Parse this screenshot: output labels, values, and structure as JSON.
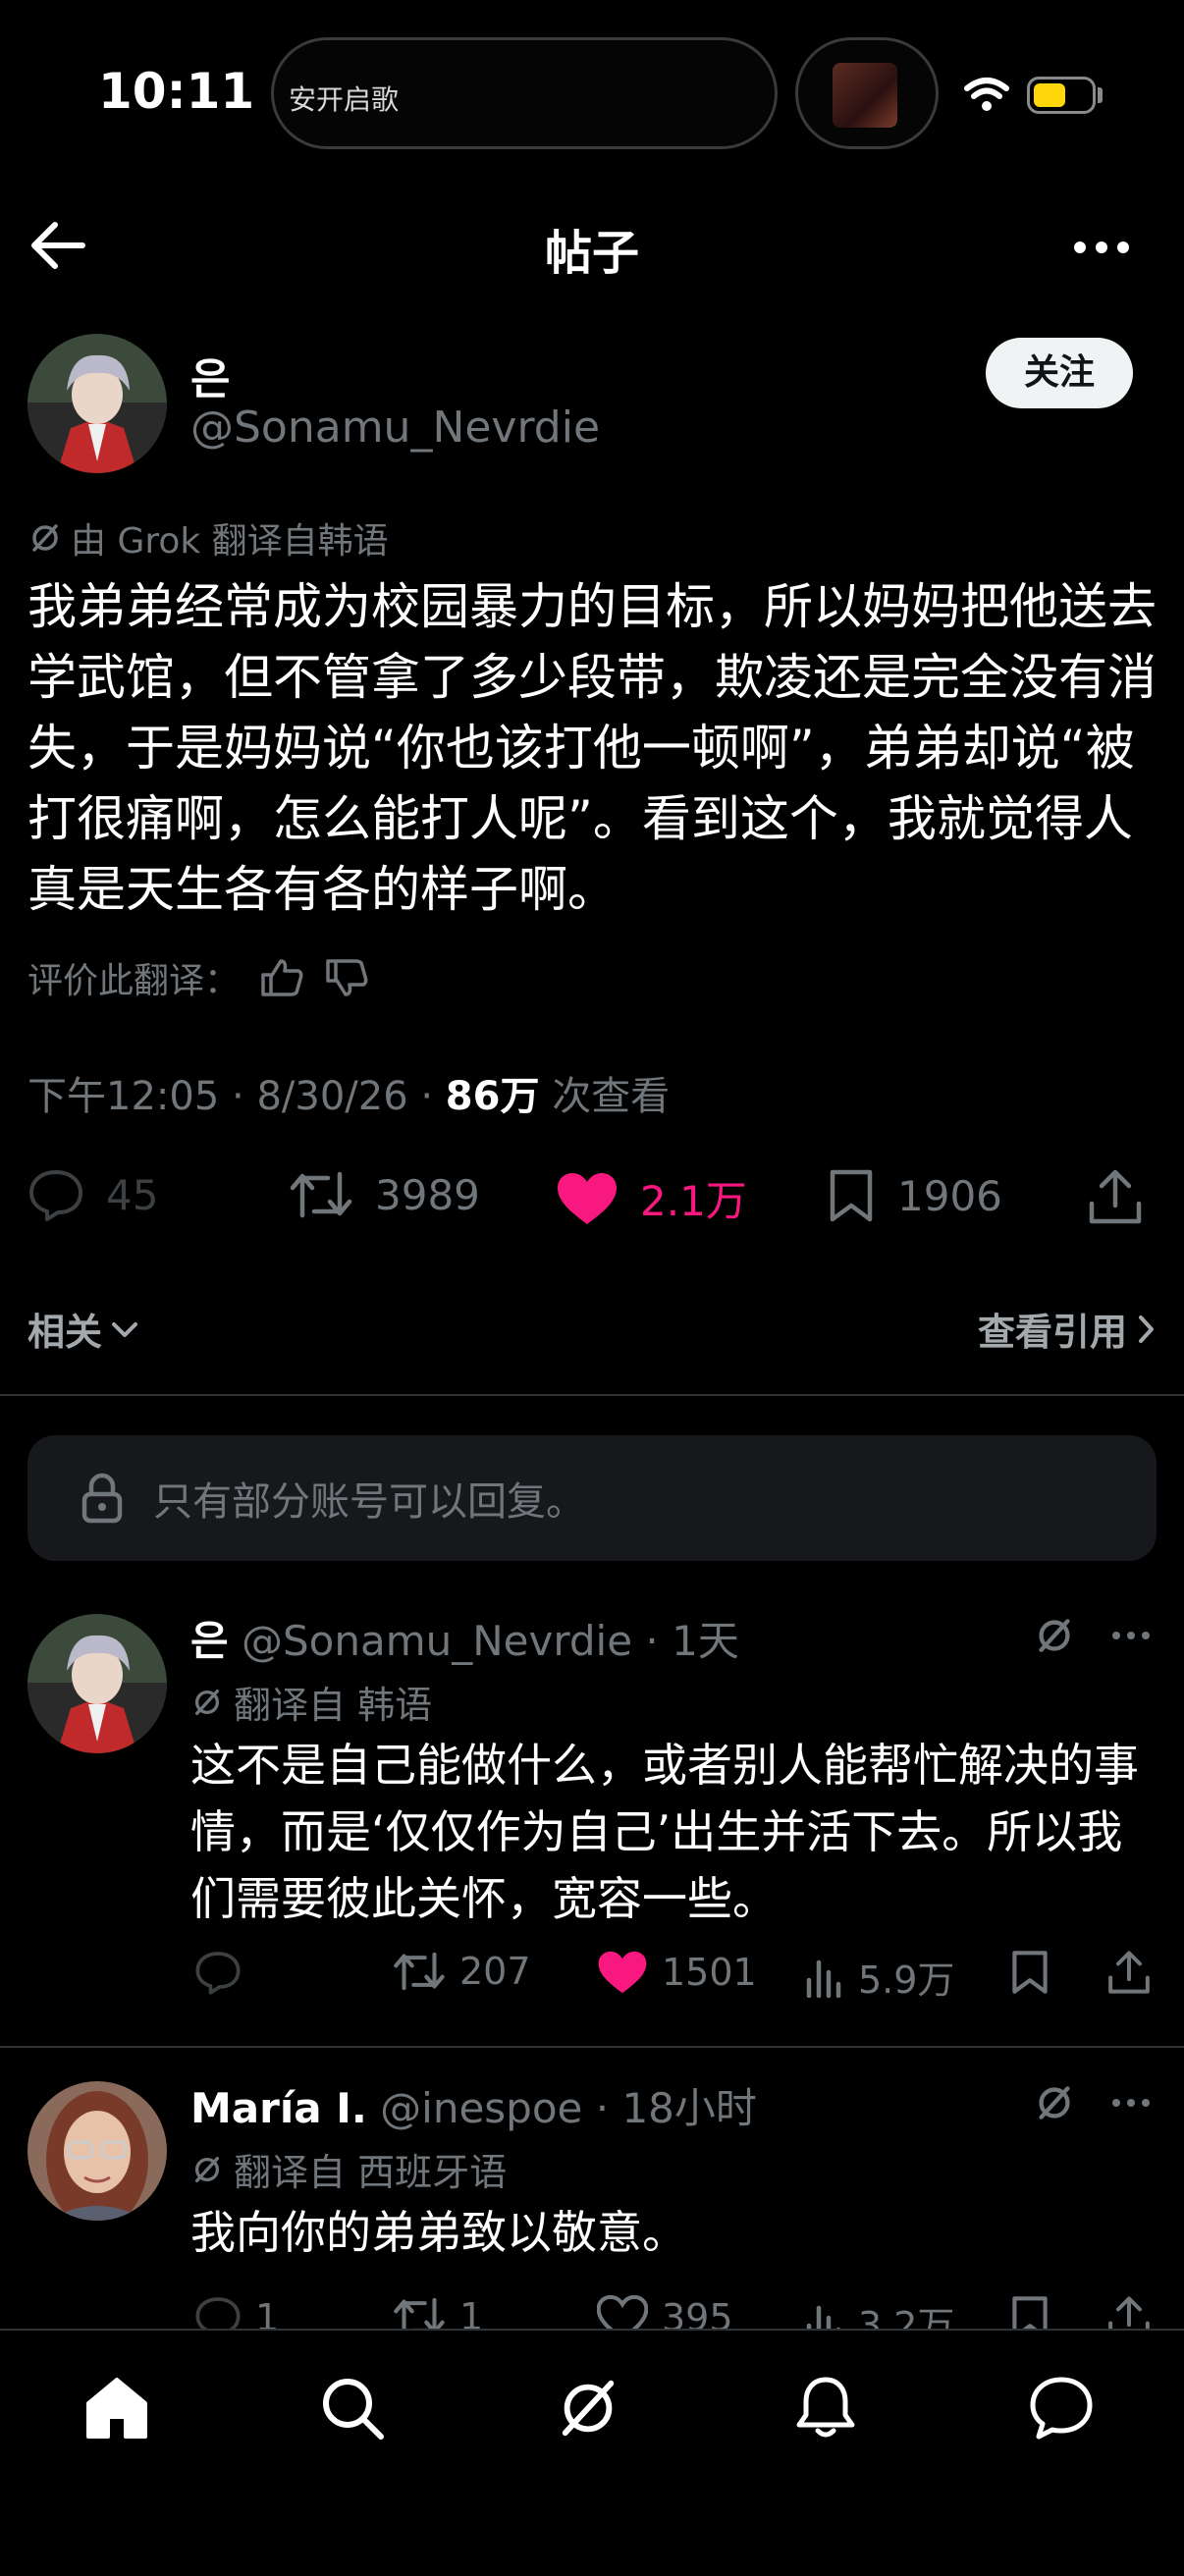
{
  "status_bar": {
    "time": "10:11",
    "now_playing": "安开启歌"
  },
  "header": {
    "title": "帖子"
  },
  "post": {
    "author_name": "은",
    "author_handle": "@Sonamu_Nevrdie",
    "follow_label": "关注",
    "translated_by": "由 Grok 翻译自韩语",
    "text": "我弟弟经常成为校园暴力的目标，所以妈妈把他送去学武馆，但不管拿了多少段带，欺凌还是完全没有消失，于是妈妈说“你也该打他一顿啊”，弟弟却说“被打很痛啊，怎么能打人呢”。看到这个，我就觉得人真是天生各有各的样子啊。",
    "rate_label": "评价此翻译：",
    "time": "下午12:05",
    "date": "8/30/26",
    "views_count": "86万",
    "views_label": "次查看",
    "replies": "45",
    "reposts": "3989",
    "likes": "2.1万",
    "bookmarks": "1906"
  },
  "related_label": "相关",
  "quotes_label": "查看引用",
  "reply_restriction": "只有部分账号可以回复。",
  "replies": [
    {
      "name": "은",
      "handle": "@Sonamu_Nevrdie",
      "time": "1天",
      "translated_from": "翻译自 韩语",
      "text": "这不是自己能做什么，或者别人能帮忙解决的事情，而是‘仅仅作为自己’出生并活下去。所以我们需要彼此关怀，宽容一些。",
      "replies": "",
      "reposts": "207",
      "likes": "1501",
      "views": "5.9万"
    },
    {
      "name": "María I.",
      "handle": "@inespoe",
      "time": "18小时",
      "translated_from": "翻译自 西班牙语",
      "text": "我向你的弟弟致以敬意。",
      "replies": "1",
      "reposts": "1",
      "likes": "395",
      "views": "3.2万"
    }
  ],
  "colors": {
    "accent_like": "#f91880",
    "muted": "#71767b",
    "background": "#000000"
  }
}
